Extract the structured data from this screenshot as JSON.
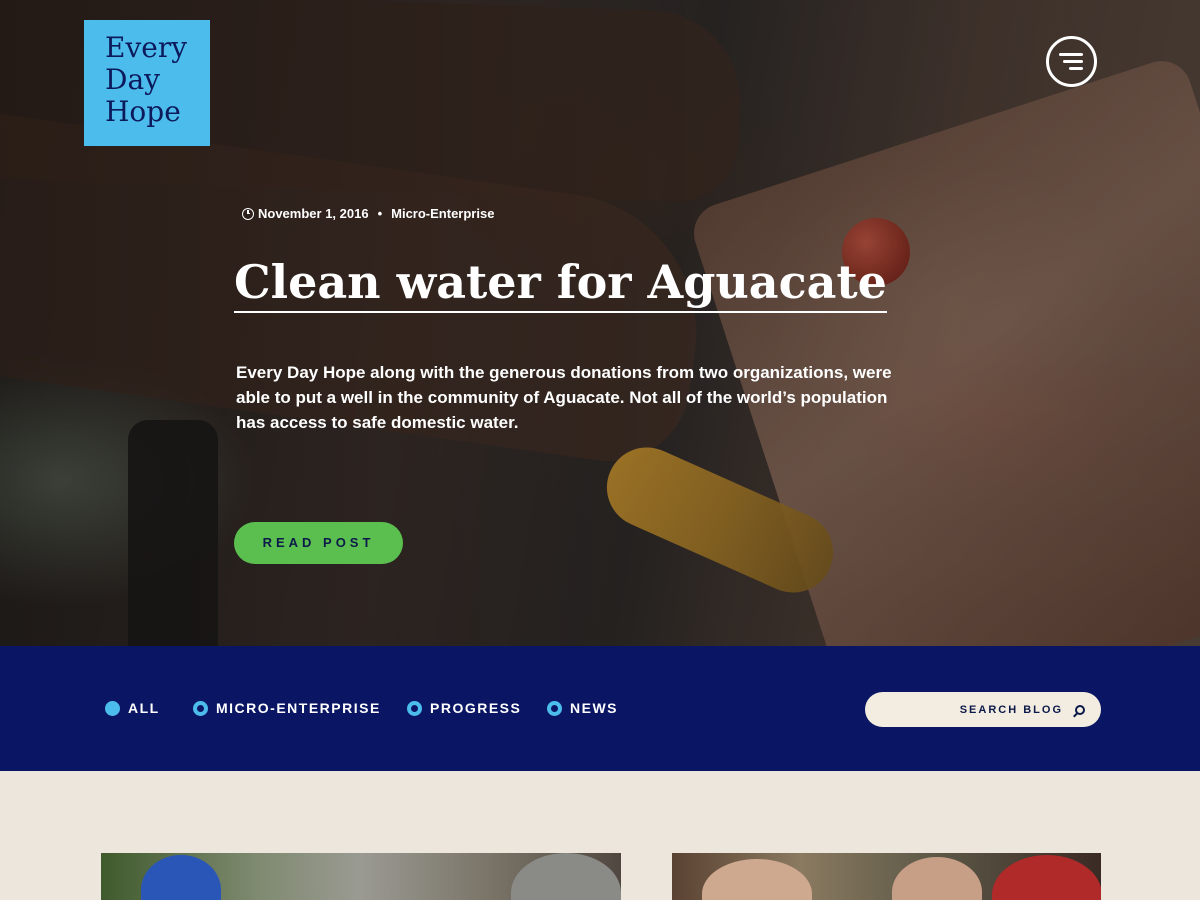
{
  "brand": {
    "line1": "Every",
    "line2": "Day",
    "line3": "Hope",
    "color": "#4cbcec"
  },
  "header": {
    "menu_icon": "hamburger-icon"
  },
  "featured_post": {
    "date": "November 1, 2016",
    "separator": "•",
    "category": "Micro-Enterprise",
    "title": "Clean water for Aguacate",
    "excerpt": "Every Day Hope along with the generous donations from two organizations, were able to put a well in the community of Aguacate. Not all of the world’s population has access to safe domestic water.",
    "cta_label": "READ POST",
    "cta_color": "#5bbf4f"
  },
  "filters": {
    "items": [
      {
        "label": "ALL",
        "selected": true
      },
      {
        "label": "MICRO-ENTERPRISE",
        "selected": false
      },
      {
        "label": "PROGRESS",
        "selected": false
      },
      {
        "label": "NEWS",
        "selected": false
      }
    ],
    "bar_color": "#0a1663",
    "search_label": "SEARCH BLOG"
  }
}
